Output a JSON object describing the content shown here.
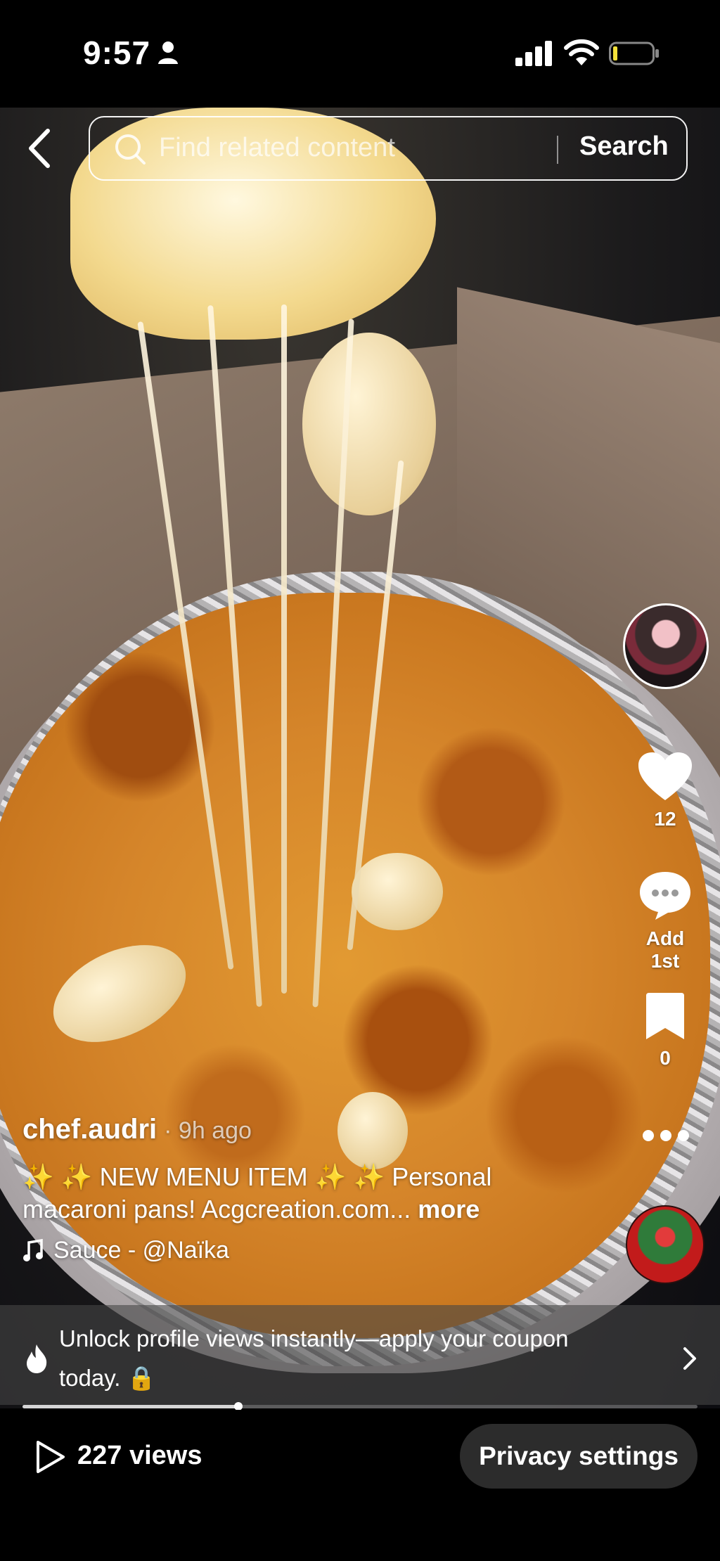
{
  "status_bar": {
    "time": "9:57"
  },
  "search": {
    "placeholder": "Find related content",
    "button_label": "Search"
  },
  "post": {
    "author": "chef.audri",
    "time_ago": "· 9h ago",
    "description": "✨ ✨ NEW MENU ITEM ✨ ✨   Personal macaroni pans! Acgcreation.com...",
    "more_label": "more",
    "music": "Sauce - @Naïka"
  },
  "rail": {
    "likes": "12",
    "comments": "Add 1st",
    "saves": "0"
  },
  "banner": {
    "text": "Unlock profile views instantly—apply your coupon today. 🔒"
  },
  "progress": {
    "fraction": 0.32
  },
  "bottom": {
    "views": "227 views",
    "privacy_label": "Privacy settings"
  },
  "colors": {
    "bar": "#000000",
    "pill": "#2c2c2c",
    "cheese": "#d5852a"
  }
}
